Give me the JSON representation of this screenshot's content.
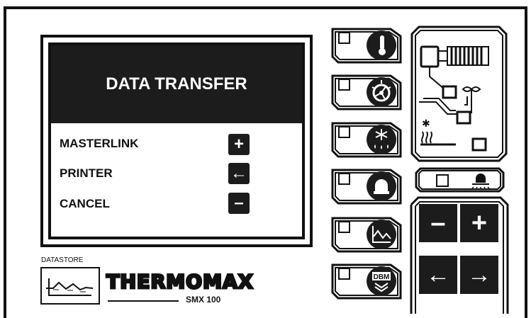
{
  "display": {
    "title": "DATA TRANSFER",
    "menu": [
      {
        "label": "MASTERLINK",
        "key_icon": "plus-icon",
        "key_glyph": "+"
      },
      {
        "label": "PRINTER",
        "key_icon": "arrow-left-icon",
        "key_glyph": "←"
      },
      {
        "label": "CANCEL",
        "key_icon": "minus-icon",
        "key_glyph": "–"
      }
    ]
  },
  "function_buttons": [
    {
      "icon": "thermometer-icon"
    },
    {
      "icon": "evaporator-fan-icon"
    },
    {
      "icon": "defrost-snowflake-icon"
    },
    {
      "icon": "alarm-light-icon"
    },
    {
      "icon": "graph-icon"
    },
    {
      "icon": "dbm-icon",
      "text": "DBM"
    }
  ],
  "schematic": {
    "icons": [
      "compressor-icon",
      "condenser-coil-icon",
      "fan-icon",
      "heater-icon"
    ]
  },
  "defrost_button": {
    "icon": "defrost-lamp-icon"
  },
  "nav_keys": [
    {
      "name": "minus-key",
      "glyph": "–"
    },
    {
      "name": "plus-key",
      "glyph": "+"
    },
    {
      "name": "left-key",
      "glyph": "←"
    },
    {
      "name": "right-key",
      "glyph": "→"
    }
  ],
  "brand": {
    "datastore_label": "DATASTORE",
    "name": "THERMOMAX",
    "model": "SMX 100"
  },
  "colors": {
    "panel_black": "#1c1c1c",
    "background": "#ffffff"
  }
}
